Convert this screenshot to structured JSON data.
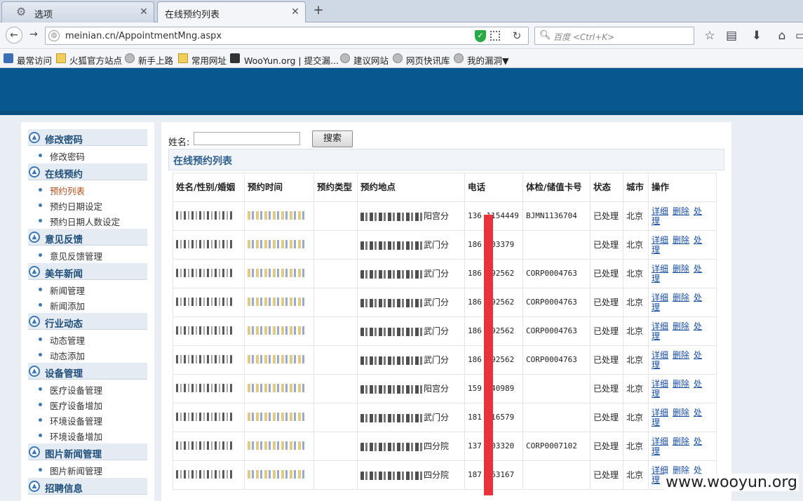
{
  "browser": {
    "tabs": [
      {
        "title": "选项",
        "active": false
      },
      {
        "title": "在线预约列表",
        "active": true
      }
    ],
    "new_tab": "+",
    "url": "meinian.cn/AppointmentMng.aspx",
    "search_placeholder": "百度 <Ctrl+K>",
    "bookmarks": [
      {
        "label": "最常访问",
        "icon": "folder-icon"
      },
      {
        "label": "火狐官方站点",
        "icon": "folder-icon"
      },
      {
        "label": "新手上路",
        "icon": "globe-icon"
      },
      {
        "label": "常用网址",
        "icon": "folder-icon"
      },
      {
        "label": "WooYun.org | 提交漏...",
        "icon": "wooyun-icon"
      },
      {
        "label": "建议网站",
        "icon": "globe-icon"
      },
      {
        "label": "网页快讯库",
        "icon": "globe-icon"
      },
      {
        "label": "我的漏洞▼",
        "icon": "globe-icon"
      }
    ]
  },
  "sidebar": {
    "sections": [
      {
        "title": "修改密码",
        "items": [
          {
            "label": "修改密码",
            "active": false
          }
        ]
      },
      {
        "title": "在线预约",
        "items": [
          {
            "label": "预约列表",
            "active": true
          },
          {
            "label": "预约日期设定",
            "active": false
          },
          {
            "label": "预约日期人数设定",
            "active": false
          }
        ]
      },
      {
        "title": "意见反馈",
        "items": [
          {
            "label": "意见反馈管理",
            "active": false
          }
        ]
      },
      {
        "title": "美年新闻",
        "items": [
          {
            "label": "新闻管理",
            "active": false
          },
          {
            "label": "新闻添加",
            "active": false
          }
        ]
      },
      {
        "title": "行业动态",
        "items": [
          {
            "label": "动态管理",
            "active": false
          },
          {
            "label": "动态添加",
            "active": false
          }
        ]
      },
      {
        "title": "设备管理",
        "items": [
          {
            "label": "医疗设备管理",
            "active": false
          },
          {
            "label": "医疗设备增加",
            "active": false
          },
          {
            "label": "环境设备管理",
            "active": false
          },
          {
            "label": "环境设备增加",
            "active": false
          }
        ]
      },
      {
        "title": "图片新闻管理",
        "items": [
          {
            "label": "图片新闻管理",
            "active": false
          }
        ]
      },
      {
        "title": "招聘信息",
        "items": []
      }
    ]
  },
  "main": {
    "search_label": "姓名:",
    "search_value": "",
    "search_button": "搜索",
    "list_title": "在线预约列表",
    "columns": [
      "姓名/性别/婚姻",
      "预约时间",
      "预约类型",
      "预约地点",
      "电话",
      "体检/储值卡号",
      "状态",
      "城市",
      "操作"
    ],
    "rows": [
      {
        "location_suffix": "阳宫分",
        "phone": "136  1154449",
        "card": "BJMN1136704",
        "status": "已处理",
        "city": "北京"
      },
      {
        "location_suffix": "武门分",
        "phone": "186  103379",
        "card": "",
        "status": "已处理",
        "city": "北京"
      },
      {
        "location_suffix": "武门分",
        "phone": "186  992562",
        "card": "CORP0004763",
        "status": "已处理",
        "city": "北京"
      },
      {
        "location_suffix": "武门分",
        "phone": "186  992562",
        "card": "CORP0004763",
        "status": "已处理",
        "city": "北京"
      },
      {
        "location_suffix": "武门分",
        "phone": "186  992562",
        "card": "CORP0004763",
        "status": "已处理",
        "city": "北京"
      },
      {
        "location_suffix": "武门分",
        "phone": "186  992562",
        "card": "CORP0004763",
        "status": "已处理",
        "city": "北京"
      },
      {
        "location_suffix": "阳宫分",
        "phone": "159  240989",
        "card": "",
        "status": "已处理",
        "city": "北京"
      },
      {
        "location_suffix": "武门分",
        "phone": "181  316579",
        "card": "",
        "status": "已处理",
        "city": "北京"
      },
      {
        "location_suffix": "四分院",
        "phone": "137  103320",
        "card": "CORP0007102",
        "status": "已处理",
        "city": "北京"
      },
      {
        "location_suffix": "四分院",
        "phone": "187  063167",
        "card": "",
        "status": "已处理",
        "city": "北京"
      }
    ],
    "actions": [
      "详细",
      "删除",
      "处理"
    ]
  },
  "watermark": "www.wooyun.org",
  "colors": {
    "banner": "#08588f",
    "accent": "#3c78b6",
    "active_link": "#b34d1c",
    "redaction": "#e8323c"
  }
}
